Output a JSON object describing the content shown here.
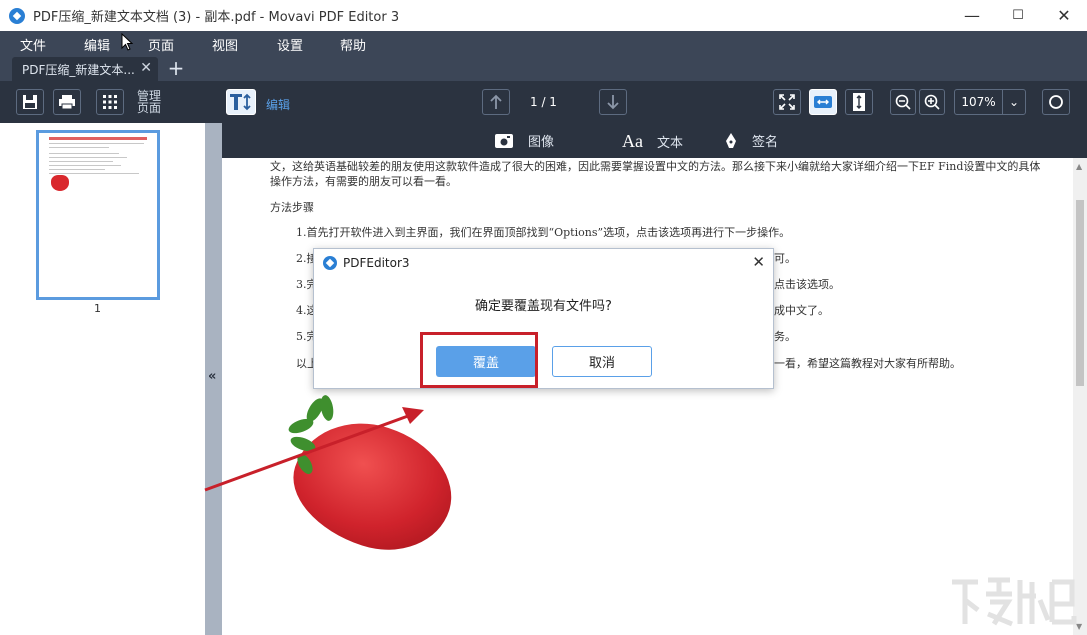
{
  "window": {
    "title": "PDF压缩_新建文本文档 (3) - 副本.pdf - Movavi PDF Editor 3",
    "minimize": "—",
    "maximize": "☐",
    "close": "✕"
  },
  "menu": [
    "文件",
    "编辑",
    "页面",
    "视图",
    "设置",
    "帮助"
  ],
  "tabs": {
    "active_label": "PDF压缩_新建文本...",
    "close": "✕",
    "add": "+"
  },
  "toolbar": {
    "manage_pages_line1": "管理",
    "manage_pages_line2": "页面",
    "edit_label": "编辑",
    "page_indicator": "1 / 1",
    "zoom": "107%"
  },
  "subtoolbar": {
    "image": "图像",
    "text": "文本",
    "signature": "签名"
  },
  "thumbnail": {
    "page_number": "1"
  },
  "document": {
    "lines": [
      "文，这给英语基础较差的朋友使用这款软件造成了很大的困难，因此需要掌握设置中文的方法。那么接下来小编就给大家详细介绍一下EF Find设置中文的具体",
      "操作方法，有需要的朋友可以看一看。",
      "方法步骤",
      "1.首先打开软件进入到主界面，我们在界面顶部找到“Options”选项，点击该选项再进行下一步操作。",
      "2.接",
      "可。",
      "3.完",
      "点击该选项。",
      "4.这",
      "成中文了。",
      "5.完",
      "务。",
      "以上",
      "一看，希望这篇教程对大家有所帮助。"
    ]
  },
  "dialog": {
    "title": "PDFEditor3",
    "close": "✕",
    "message": "确定要覆盖现有文件吗?",
    "ok": "覆盖",
    "cancel": "取消"
  },
  "colors": {
    "accent": "#5aa0e8",
    "highlight": "#c8202a",
    "toolbar_bg": "#2b3340"
  }
}
